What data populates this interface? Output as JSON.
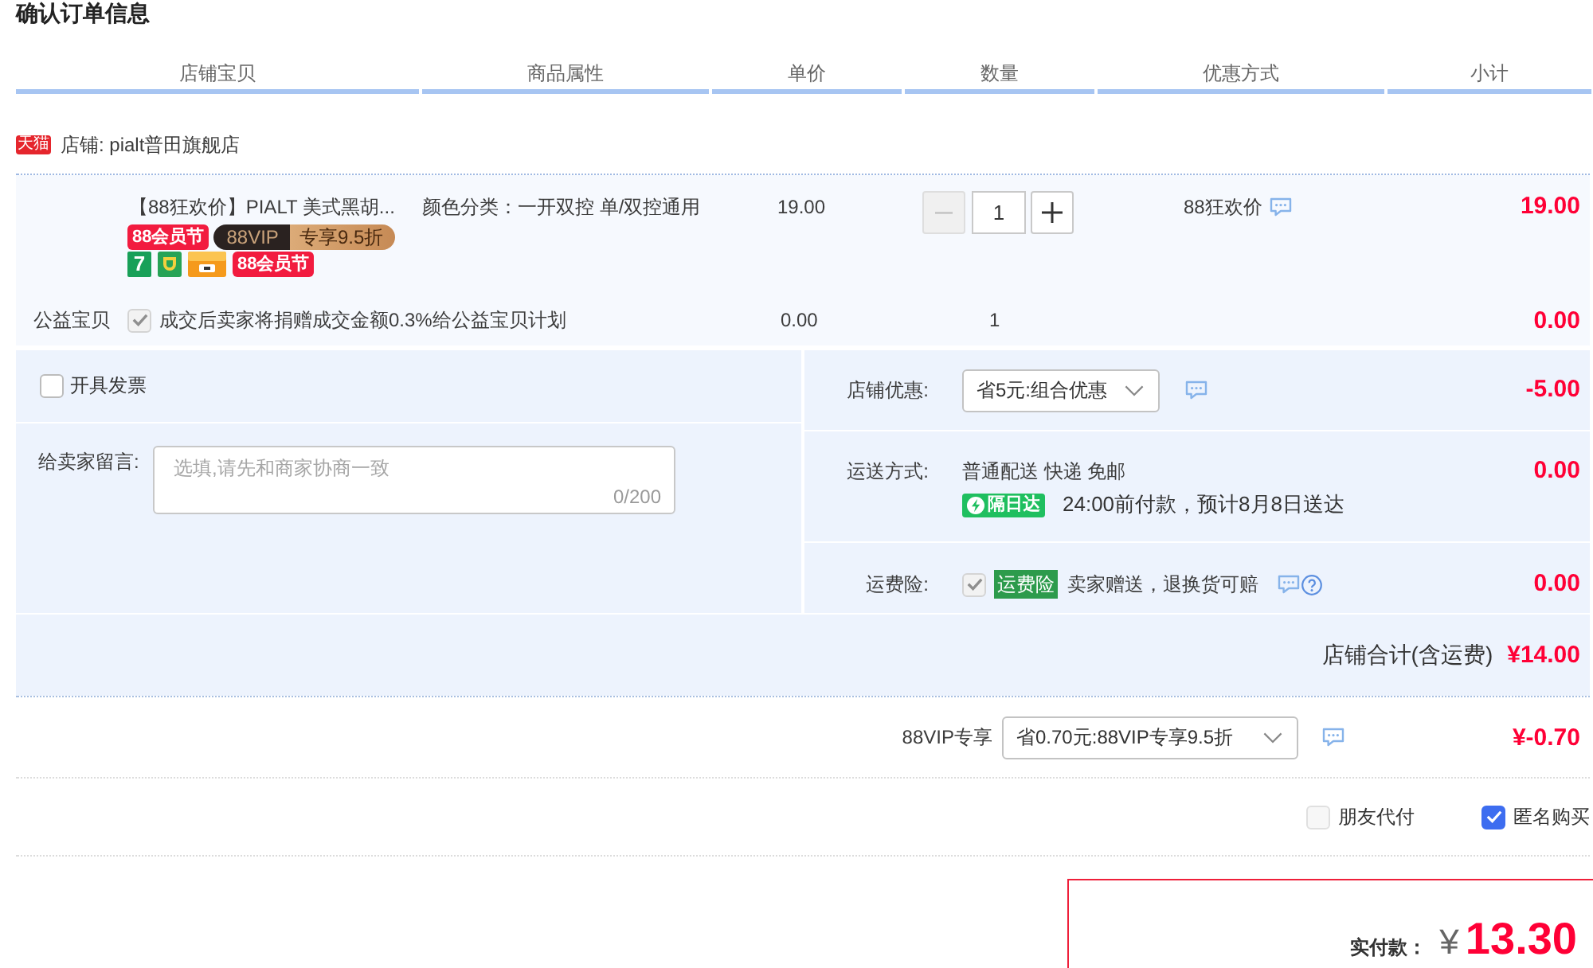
{
  "title": "确认订单信息",
  "columns": [
    "店铺宝贝",
    "商品属性",
    "单价",
    "数量",
    "优惠方式",
    "小计"
  ],
  "shop": {
    "logo_text": "天猫",
    "label": "店铺: pialt普田旗舰店"
  },
  "item": {
    "title": "【88狂欢价】PIALT 美式黑胡...",
    "promo_badges": [
      {
        "kind": "festival",
        "text": "88会员节"
      },
      {
        "kind": "vip",
        "text": "88VIP",
        "offer": "专享9.5折"
      }
    ],
    "service_badges": [
      {
        "kind": "number",
        "text": "7"
      },
      {
        "kind": "shield"
      },
      {
        "kind": "card"
      },
      {
        "kind": "festival",
        "text": "88会员节"
      }
    ],
    "attributes": "颜色分类：一开双控 单/双控通用",
    "unit_price": "19.00",
    "quantity": {
      "value": "1",
      "decrease_disabled": true,
      "increase_disabled": false
    },
    "promotion": "88狂欢价",
    "subtotal": "19.00"
  },
  "charity": {
    "label": "公益宝贝",
    "checked": true,
    "disabled": true,
    "text": "成交后卖家将捐赠成交金额0.3%给公益宝贝计划",
    "unit_price": "0.00",
    "quantity": "1",
    "subtotal": "0.00"
  },
  "invoice": {
    "label": "开具发票",
    "checked": false
  },
  "message": {
    "label": "给卖家留言:",
    "placeholder": "选填,请先和商家协商一致",
    "counter": "0/200"
  },
  "shop_discount": {
    "label": "店铺优惠:",
    "value": "省5元:组合优惠",
    "amount": "-5.00"
  },
  "shipping": {
    "label": "运送方式:",
    "method": "普通配送 快递 免邮",
    "badge": "隔日达",
    "note": "24:00前付款，预计8月8日送达",
    "amount": "0.00"
  },
  "shipping_insurance": {
    "label": "运费险:",
    "checked": true,
    "disabled": true,
    "tag": "运费险",
    "text": "卖家赠送，退换货可赔",
    "amount": "0.00"
  },
  "shop_total": {
    "label": "店铺合计(含运费)",
    "amount": "¥14.00"
  },
  "vip_discount": {
    "label": "88VIP专享",
    "value": "省0.70元:88VIP专享9.5折",
    "amount": "¥-0.70"
  },
  "options": [
    {
      "label": "朋友代付",
      "checked": false
    },
    {
      "label": "匿名购买",
      "checked": true
    }
  ],
  "payment": {
    "label": "实付款：",
    "currency": "¥",
    "amount": "13.30"
  }
}
